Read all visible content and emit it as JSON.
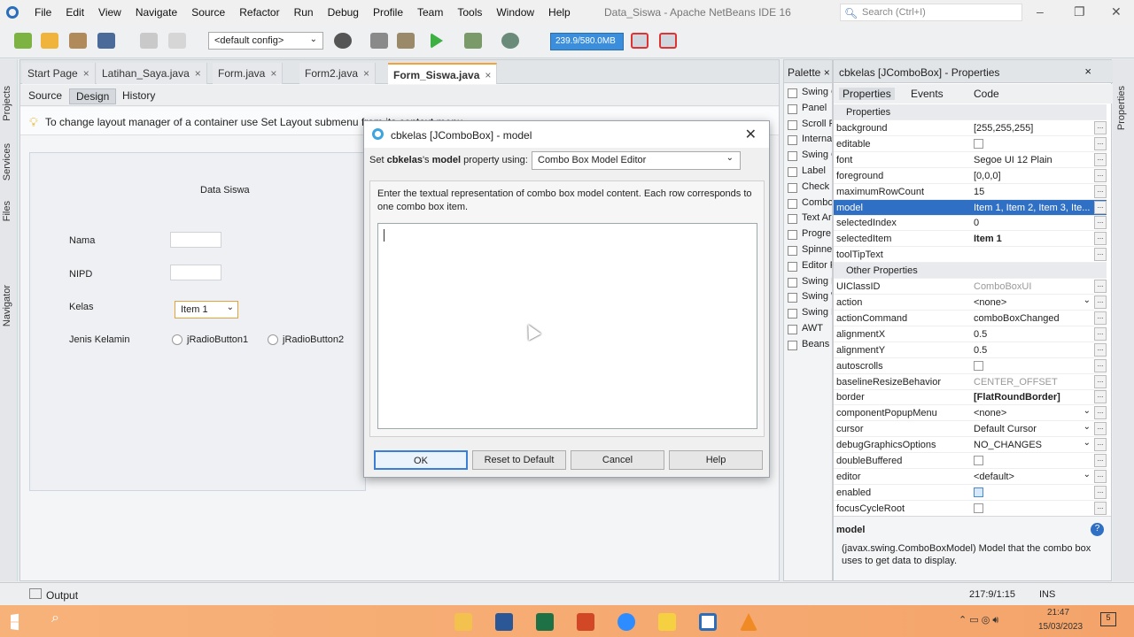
{
  "menu": [
    "File",
    "Edit",
    "View",
    "Navigate",
    "Source",
    "Refactor",
    "Run",
    "Debug",
    "Profile",
    "Team",
    "Tools",
    "Window",
    "Help"
  ],
  "window_title": "Data_Siswa - Apache NetBeans IDE 16",
  "search_placeholder": "Search (Ctrl+I)",
  "config": "<default config>",
  "memory": "239.9/580.0MB",
  "editor_tabs": [
    {
      "label": "Start Page",
      "active": false
    },
    {
      "label": "Latihan_Saya.java",
      "active": false
    },
    {
      "label": "Form.java",
      "active": false
    },
    {
      "label": "Form2.java",
      "active": false
    },
    {
      "label": "Form_Siswa.java",
      "active": true
    }
  ],
  "sub_tabs": [
    "Source",
    "Design",
    "History"
  ],
  "hint": "To change layout manager of a container use Set Layout submenu from its context menu.",
  "form": {
    "title": "Data Siswa",
    "labels": [
      "Nama",
      "NIPD",
      "Kelas",
      "Jenis Kelamin"
    ],
    "combo_value": "Item 1",
    "radio1": "jRadioButton1",
    "radio2": "jRadioButton2"
  },
  "sidebar_tabs": [
    "Projects",
    "Services",
    "Files",
    "Navigator"
  ],
  "palette": {
    "title": "Palette",
    "items": [
      "Swing C",
      "Panel",
      "Scroll P",
      "Interna",
      "Swing C",
      "Label",
      "Check",
      "Combo",
      "Text Ar",
      "Progre",
      "Spinne",
      "Editor P",
      "Swing M",
      "Swing W",
      "Swing F",
      "AWT",
      "Beans"
    ]
  },
  "properties": {
    "title": "cbkelas [JComboBox] - Properties",
    "tabs": [
      "Properties",
      "Events",
      "Code"
    ],
    "section1": "Properties",
    "rows1": [
      {
        "k": "background",
        "v": "[255,255,255]"
      },
      {
        "k": "editable",
        "v": ""
      },
      {
        "k": "font",
        "v": "Segoe UI 12 Plain"
      },
      {
        "k": "foreground",
        "v": "[0,0,0]"
      },
      {
        "k": "maximumRowCount",
        "v": "15"
      },
      {
        "k": "model",
        "v": "Item 1, Item 2, Item 3, Ite..."
      },
      {
        "k": "selectedIndex",
        "v": "0"
      },
      {
        "k": "selectedItem",
        "v": "Item 1"
      },
      {
        "k": "toolTipText",
        "v": ""
      }
    ],
    "section2": "Other Properties",
    "rows2": [
      {
        "k": "UIClassID",
        "v": "ComboBoxUI"
      },
      {
        "k": "action",
        "v": "<none>"
      },
      {
        "k": "actionCommand",
        "v": "comboBoxChanged"
      },
      {
        "k": "alignmentX",
        "v": "0.5"
      },
      {
        "k": "alignmentY",
        "v": "0.5"
      },
      {
        "k": "autoscrolls",
        "v": ""
      },
      {
        "k": "baselineResizeBehavior",
        "v": "CENTER_OFFSET"
      },
      {
        "k": "border",
        "v": "[FlatRoundBorder]"
      },
      {
        "k": "componentPopupMenu",
        "v": "<none>"
      },
      {
        "k": "cursor",
        "v": "Default Cursor"
      },
      {
        "k": "debugGraphicsOptions",
        "v": "NO_CHANGES"
      },
      {
        "k": "doubleBuffered",
        "v": ""
      },
      {
        "k": "editor",
        "v": "<default>"
      },
      {
        "k": "enabled",
        "v": ""
      },
      {
        "k": "focusCycleRoot",
        "v": ""
      }
    ],
    "help_title": "model",
    "help_text": "(javax.swing.ComboBoxModel) Model that the combo box uses to get data to display."
  },
  "dialog": {
    "title": "cbkelas [JComboBox] - model",
    "set_prefix": "Set ",
    "set_bold1": "cbkelas",
    "set_mid": "'s ",
    "set_bold2": "model",
    "set_suffix": " property using:",
    "editor_option": "Combo Box Model Editor",
    "description": "Enter the textual representation of combo box model content. Each row corresponds to one combo box item.",
    "buttons": [
      "OK",
      "Reset to Default",
      "Cancel",
      "Help"
    ]
  },
  "status": {
    "output": "Output",
    "position": "217:9/1:15",
    "mode": "INS"
  },
  "clock": {
    "time": "21:47",
    "date": "15/03/2023"
  },
  "notif_count": "5"
}
